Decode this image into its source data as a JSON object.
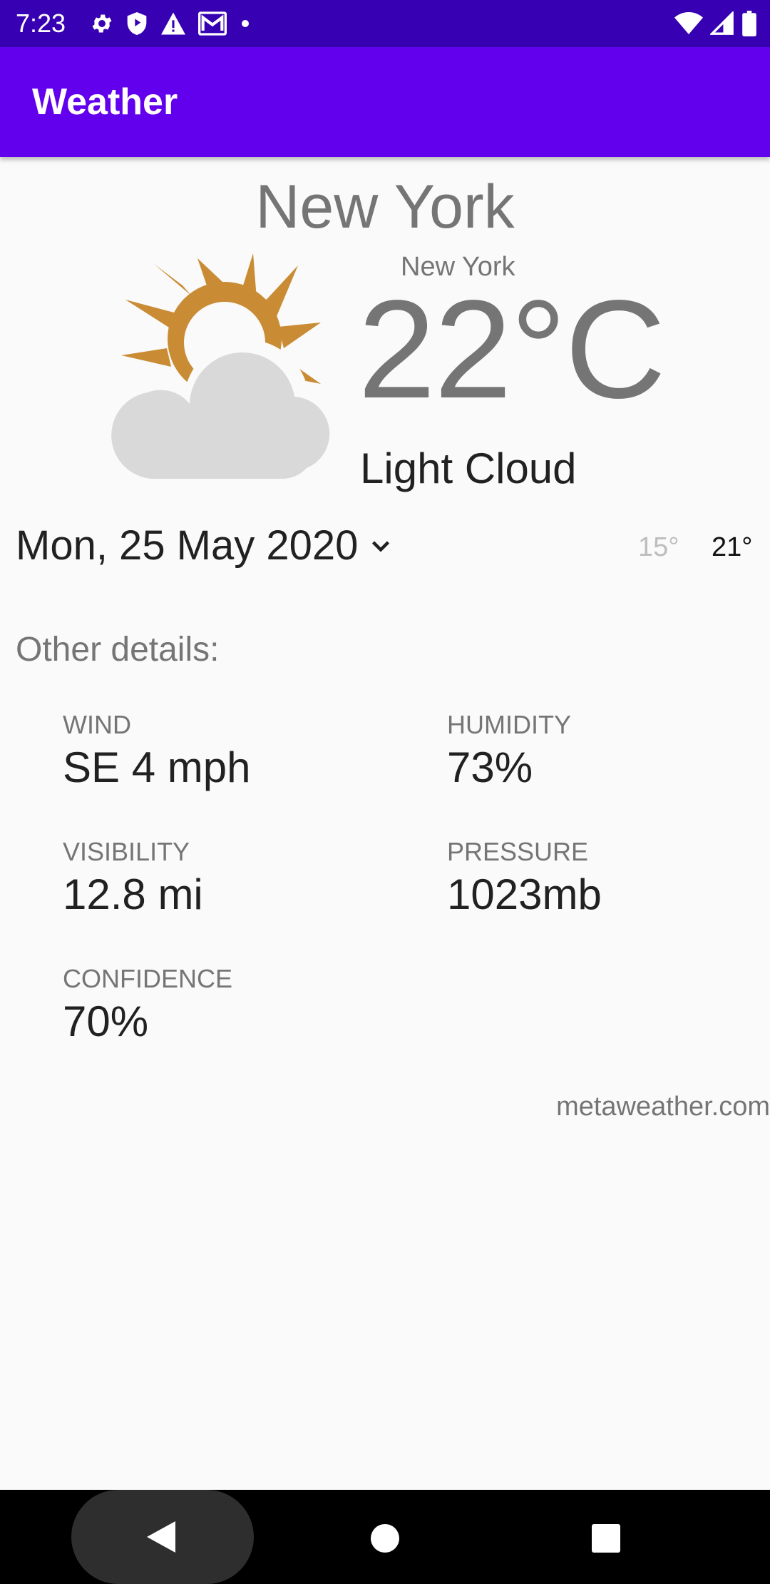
{
  "status_bar": {
    "time": "7:23",
    "icons_left": [
      "gear-icon",
      "shield-icon",
      "warning-icon",
      "mail-icon",
      "dot-icon"
    ],
    "icons_right": [
      "wifi-icon",
      "signal-icon",
      "battery-icon"
    ]
  },
  "app_bar": {
    "title": "Weather"
  },
  "location": {
    "city": "New York",
    "sub_city": "New York"
  },
  "current": {
    "temperature": "22°C",
    "condition": "Light Cloud",
    "icon": "light-cloud-icon"
  },
  "date_selector": {
    "label": "Mon, 25 May 2020",
    "icon": "chevron-down-icon"
  },
  "range": {
    "low": "15°",
    "high": "21°"
  },
  "details": {
    "heading": "Other details:",
    "wind": {
      "label": "WIND",
      "value": "SE 4 mph"
    },
    "humidity": {
      "label": "HUMIDITY",
      "value": "73%"
    },
    "visibility": {
      "label": "VISIBILITY",
      "value": "12.8 mi"
    },
    "pressure": {
      "label": "PRESSURE",
      "value": "1023mb"
    },
    "confidence": {
      "label": "CONFIDENCE",
      "value": "70%"
    }
  },
  "source": "metaweather.com",
  "colors": {
    "status_bar": "#3700b3",
    "app_bar": "#6200ee",
    "sun": "#c98c35",
    "cloud": "#d9d9d9",
    "background": "#fafafa"
  },
  "nav_bar": {
    "buttons": [
      "back-icon",
      "home-icon",
      "recents-icon"
    ]
  }
}
